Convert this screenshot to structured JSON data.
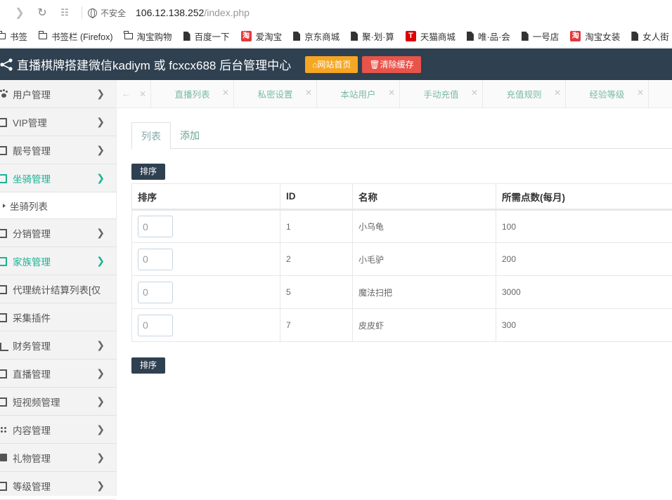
{
  "browser": {
    "security": "不安全",
    "url_host": "106.12.138.252",
    "url_path": "/index.php",
    "bookmarks": [
      {
        "label": "书签",
        "icon": "folder-icon"
      },
      {
        "label": "书签栏 (Firefox)",
        "icon": "folder-icon"
      },
      {
        "label": "淘宝购物",
        "icon": "folder-icon"
      },
      {
        "label": "百度一下",
        "icon": "page-icon"
      },
      {
        "label": "爱淘宝",
        "icon": "taobao-icon"
      },
      {
        "label": "京东商城",
        "icon": "page-icon"
      },
      {
        "label": "聚·划·算",
        "icon": "page-icon"
      },
      {
        "label": "天猫商城",
        "icon": "tmall-icon"
      },
      {
        "label": "唯·品·会",
        "icon": "page-icon"
      },
      {
        "label": "一号店",
        "icon": "page-icon"
      },
      {
        "label": "淘宝女装",
        "icon": "taobao-icon"
      },
      {
        "label": "女人街",
        "icon": "page-icon"
      }
    ]
  },
  "header": {
    "title": "直播棋牌搭建微信kadiym 或 fcxcx688 后台管理中心",
    "home_btn": "网站首页",
    "cache_btn": "清除缓存"
  },
  "sidebar": {
    "items": [
      {
        "label": "用户管理",
        "icon": "paw-icon",
        "chevron": true
      },
      {
        "label": "VIP管理",
        "icon": "monitor-icon",
        "chevron": true
      },
      {
        "label": "靓号管理",
        "icon": "monitor-icon",
        "chevron": true
      },
      {
        "label": "坐骑管理",
        "icon": "monitor-icon",
        "chevron": true,
        "active": true
      },
      {
        "label": "坐骑列表",
        "sub": true
      },
      {
        "label": "分销管理",
        "icon": "monitor-icon",
        "chevron": true
      },
      {
        "label": "家族管理",
        "icon": "monitor-icon",
        "chevron": true,
        "active": true
      },
      {
        "label": "代理统计结算列表[仅",
        "icon": "monitor-icon",
        "chevron": false
      },
      {
        "label": "采集插件",
        "icon": "monitor-icon",
        "chevron": false
      },
      {
        "label": "财务管理",
        "icon": "chart-icon",
        "chevron": true
      },
      {
        "label": "直播管理",
        "icon": "monitor-icon",
        "chevron": true
      },
      {
        "label": "短视频管理",
        "icon": "monitor-icon",
        "chevron": true
      },
      {
        "label": "内容管理",
        "icon": "grid-icon",
        "chevron": true
      },
      {
        "label": "礼物管理",
        "icon": "gift-icon",
        "chevron": true
      },
      {
        "label": "等级管理",
        "icon": "monitor-icon",
        "chevron": true
      }
    ]
  },
  "tabs": [
    "直播列表",
    "私密设置",
    "本站用户",
    "手动充值",
    "充值规则",
    "经验等级"
  ],
  "content": {
    "subtabs": [
      "列表",
      "添加"
    ],
    "sort_label": "排序",
    "columns": [
      "排序",
      "ID",
      "名称",
      "所需点数(每月)"
    ],
    "rows": [
      {
        "order": "0",
        "id": "1",
        "name": "小乌龟",
        "points": "100"
      },
      {
        "order": "0",
        "id": "2",
        "name": "小毛驴",
        "points": "200"
      },
      {
        "order": "0",
        "id": "5",
        "name": "魔法扫把",
        "points": "3000"
      },
      {
        "order": "0",
        "id": "7",
        "name": "皮皮虾",
        "points": "300"
      }
    ]
  }
}
